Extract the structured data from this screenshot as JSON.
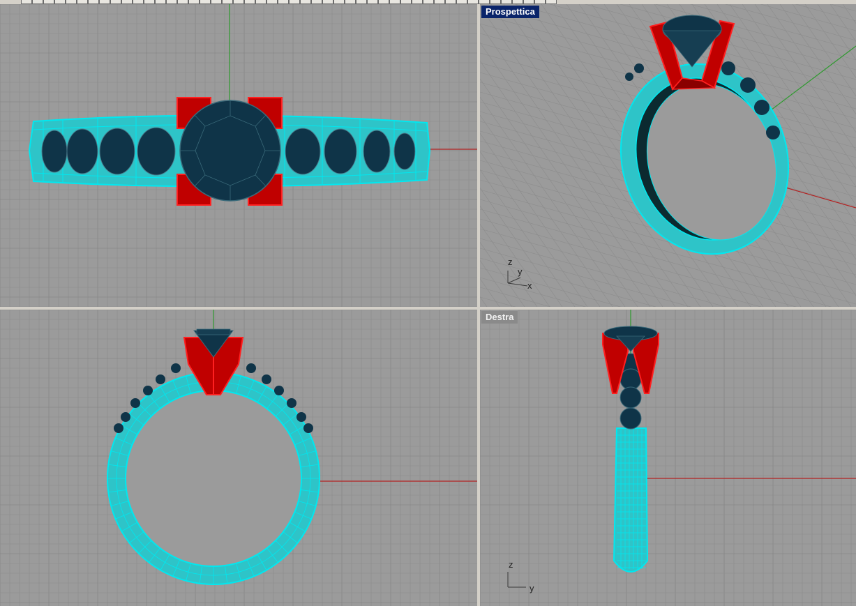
{
  "viewports": {
    "top": {
      "title": ""
    },
    "perspective": {
      "title": "Prospettica",
      "active": true
    },
    "front": {
      "title": ""
    },
    "right": {
      "title": "Destra",
      "active": false
    }
  },
  "axis_labels": {
    "perspective": {
      "z": "z",
      "y": "y",
      "x": "x"
    },
    "right": {
      "z": "z",
      "y": "y"
    }
  },
  "colors": {
    "viewport_background": "#9b9b9b",
    "grid_line": "#8c8c8c",
    "grid_major": "#808080",
    "x_axis": "#b22222",
    "y_axis": "#2e9a2e",
    "band_wireframe": "#00e8f0",
    "band_fill": "#2ec4c8",
    "prong_wireframe": "#ff2020",
    "prong_fill": "#c00000",
    "gem_fill": "#0f3448",
    "active_title_bg": "#0a246a",
    "inactive_title_bg": "#8a8a8a"
  },
  "icons": [
    "toolbar-icon"
  ]
}
